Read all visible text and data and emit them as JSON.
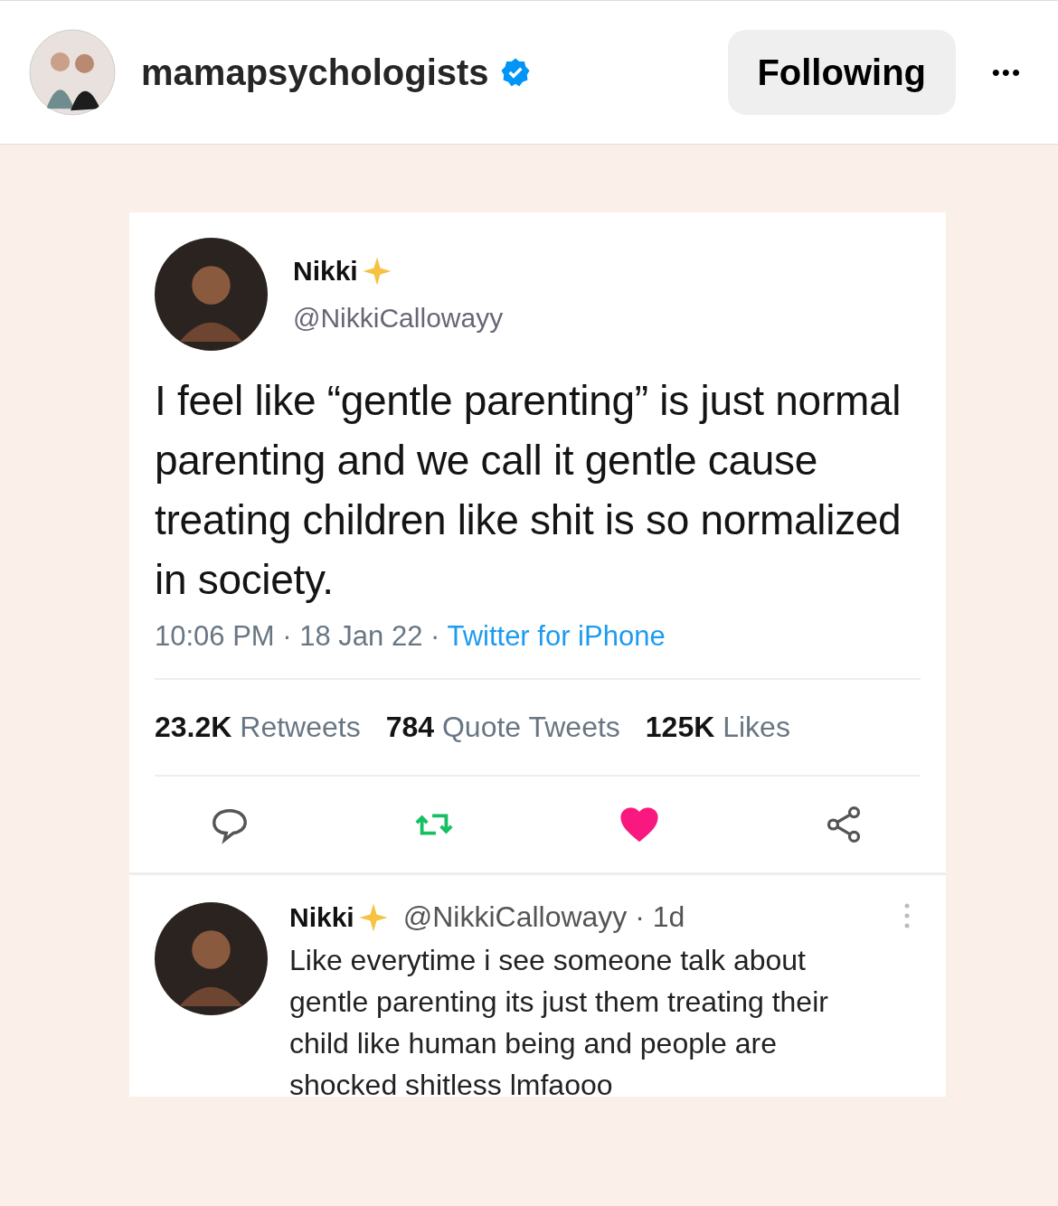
{
  "post_header": {
    "username": "mamapsychologists",
    "verified": true,
    "follow_button": "Following",
    "more": "•••"
  },
  "tweet": {
    "name": "Nikki",
    "handle": "@NikkiCallowayy",
    "text": "I feel like “gentle parenting” is just normal parenting and we call it gentle cause treating children like shit is so normalized in society.",
    "time": "10:06 PM · 18 Jan 22 · ",
    "source": "Twitter for iPhone",
    "stats": [
      {
        "count": "23.2K",
        "label": "Retweets"
      },
      {
        "count": "784",
        "label": "Quote Tweets"
      },
      {
        "count": "125K",
        "label": "Likes"
      }
    ],
    "liked": true
  },
  "reply": {
    "name": "Nikki",
    "handle": "@NikkiCallowayy · 1d",
    "text": "Like everytime i see someone talk about gentle parenting its just them treating their child like human being and people are shocked shitless lmfaooo"
  }
}
